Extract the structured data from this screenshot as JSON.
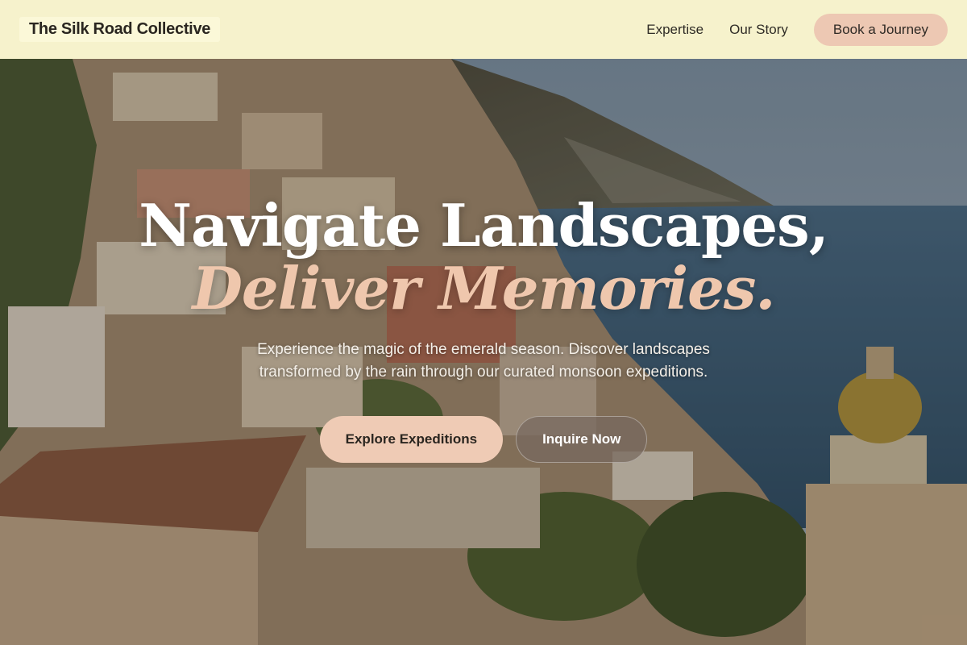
{
  "header": {
    "brand": "The Silk Road Collective",
    "nav": [
      {
        "label": "Expertise"
      },
      {
        "label": "Our Story"
      }
    ],
    "cta_label": "Book a Journey"
  },
  "hero": {
    "headline_line1": "Navigate Landscapes,",
    "headline_line2": "Deliver Memories.",
    "subtitle": "Experience the magic of the emerald season. Discover landscapes transformed by the rain through our curated monsoon expeditions.",
    "primary_cta": "Explore Expeditions",
    "secondary_cta": "Inquire Now"
  },
  "colors": {
    "header_bg": "#f6f2cc",
    "accent_peach": "#efcbb5",
    "headline_italic": "#efc7ad"
  }
}
